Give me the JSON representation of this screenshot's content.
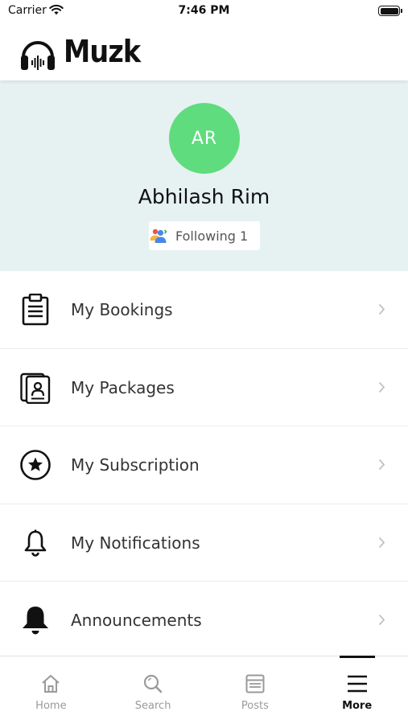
{
  "status_bar": {
    "carrier": "Carrier",
    "time": "7:46 PM"
  },
  "header": {
    "app_name": "Muzk",
    "logo_icon": "headphones-waveform-icon"
  },
  "profile": {
    "initials": "AR",
    "avatar_color": "#5fdc7e",
    "name": "Abhilash Rim",
    "following_label": "Following 1",
    "following_icon": "people-icon",
    "background_color": "#e6f1f1"
  },
  "menu": [
    {
      "label": "My Bookings",
      "icon": "clipboard-icon"
    },
    {
      "label": "My Packages",
      "icon": "id-card-icon"
    },
    {
      "label": "My Subscription",
      "icon": "star-circle-icon"
    },
    {
      "label": "My Notifications",
      "icon": "bell-outline-icon"
    },
    {
      "label": "Announcements",
      "icon": "bell-filled-icon"
    }
  ],
  "tab_bar": {
    "tabs": [
      {
        "label": "Home",
        "icon": "home-icon",
        "active": false
      },
      {
        "label": "Search",
        "icon": "search-icon",
        "active": false
      },
      {
        "label": "Posts",
        "icon": "posts-icon",
        "active": false
      },
      {
        "label": "More",
        "icon": "menu-icon",
        "active": true
      }
    ]
  }
}
